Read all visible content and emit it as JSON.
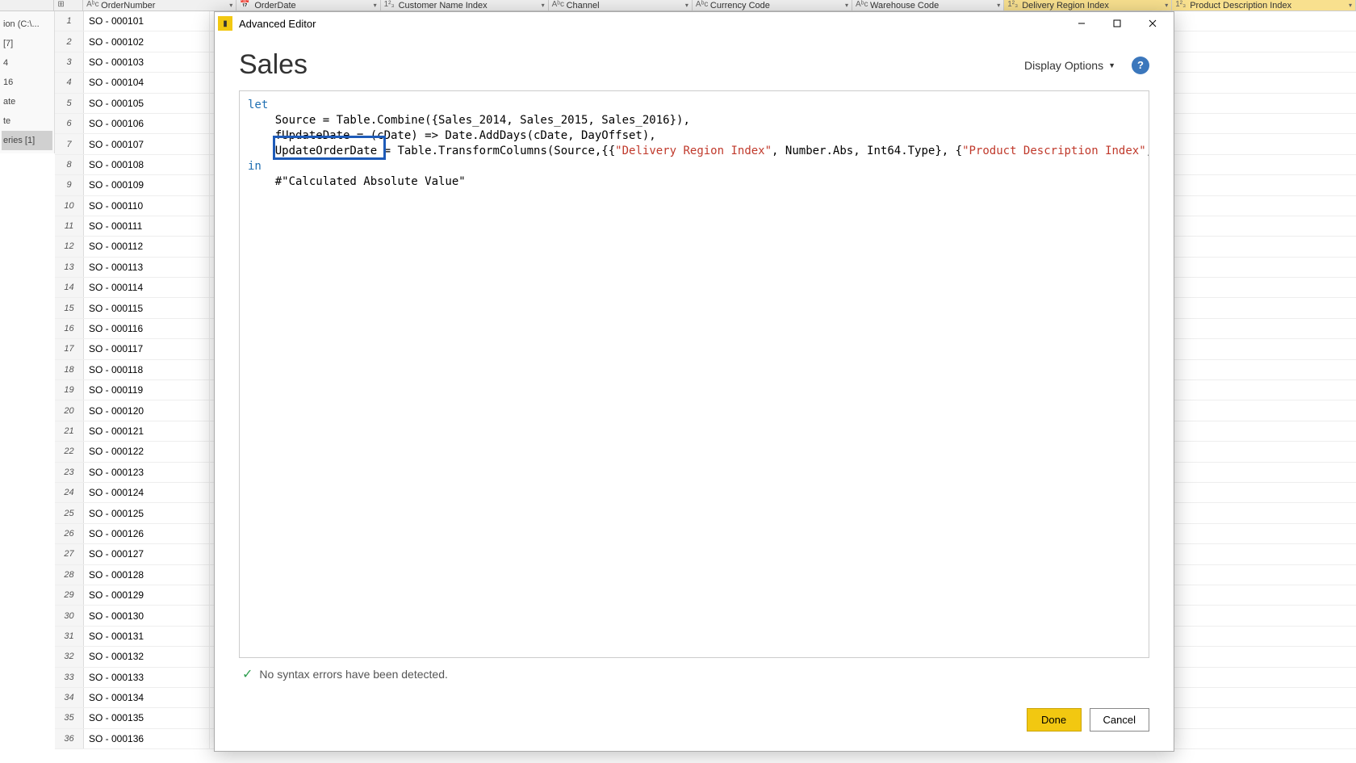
{
  "window": {
    "title": "Advanced Editor"
  },
  "query_name": "Sales",
  "display_options_label": "Display Options",
  "help_tooltip": "?",
  "editor": {
    "kw_let": "let",
    "line2_pre": "    Source = Table.Combine({Sales_2014, Sales_2015, Sales_2016}),",
    "line3_full": "    fUpdateDate = (cDate) => Date.AddDays(cDate, DayOffset),",
    "line4_name": "UpdateOrderDate",
    "line4_mid": " = Table.TransformColumns(Source,{{",
    "line4_s1": "\"Delivery Region Index\"",
    "line4_mid2": ", Number.Abs, Int64.Type}, {",
    "line4_s2": "\"Product Description Index\"",
    "line4_end": ", Number..",
    "kw_in": "in",
    "line6": "    #\"Calculated Absolute Value\""
  },
  "status_text": "No syntax errors have been detected.",
  "buttons": {
    "done": "Done",
    "cancel": "Cancel"
  },
  "grid": {
    "headers": {
      "rownum_hdr": "",
      "c1": "OrderNumber",
      "c2": "OrderDate",
      "c3": "Customer Name Index",
      "c4": "Channel",
      "c5": "Currency Code",
      "c6": "Warehouse Code",
      "c7": "Delivery Region Index",
      "c8": "Product Description Index"
    },
    "left_items": [
      "ion (C:\\...",
      "[7]",
      "4",
      "16",
      "ate",
      "te",
      "eries [1]"
    ],
    "rows": [
      {
        "n": "1",
        "o": "SO - 000101"
      },
      {
        "n": "2",
        "o": "SO - 000102"
      },
      {
        "n": "3",
        "o": "SO - 000103"
      },
      {
        "n": "4",
        "o": "SO - 000104"
      },
      {
        "n": "5",
        "o": "SO - 000105"
      },
      {
        "n": "6",
        "o": "SO - 000106"
      },
      {
        "n": "7",
        "o": "SO - 000107"
      },
      {
        "n": "8",
        "o": "SO - 000108"
      },
      {
        "n": "9",
        "o": "SO - 000109"
      },
      {
        "n": "10",
        "o": "SO - 000110"
      },
      {
        "n": "11",
        "o": "SO - 000111"
      },
      {
        "n": "12",
        "o": "SO - 000112"
      },
      {
        "n": "13",
        "o": "SO - 000113"
      },
      {
        "n": "14",
        "o": "SO - 000114"
      },
      {
        "n": "15",
        "o": "SO - 000115"
      },
      {
        "n": "16",
        "o": "SO - 000116"
      },
      {
        "n": "17",
        "o": "SO - 000117"
      },
      {
        "n": "18",
        "o": "SO - 000118"
      },
      {
        "n": "19",
        "o": "SO - 000119"
      },
      {
        "n": "20",
        "o": "SO - 000120"
      },
      {
        "n": "21",
        "o": "SO - 000121"
      },
      {
        "n": "22",
        "o": "SO - 000122"
      },
      {
        "n": "23",
        "o": "SO - 000123"
      },
      {
        "n": "24",
        "o": "SO - 000124"
      },
      {
        "n": "25",
        "o": "SO - 000125"
      },
      {
        "n": "26",
        "o": "SO - 000126"
      },
      {
        "n": "27",
        "o": "SO - 000127"
      },
      {
        "n": "28",
        "o": "SO - 000128"
      },
      {
        "n": "29",
        "o": "SO - 000129"
      },
      {
        "n": "30",
        "o": "SO - 000130"
      },
      {
        "n": "31",
        "o": "SO - 000131"
      },
      {
        "n": "32",
        "o": "SO - 000132"
      },
      {
        "n": "33",
        "o": "SO - 000133"
      },
      {
        "n": "34",
        "o": "SO - 000134"
      },
      {
        "n": "35",
        "o": "SO - 000135"
      },
      {
        "n": "36",
        "o": "SO - 000136"
      }
    ]
  }
}
